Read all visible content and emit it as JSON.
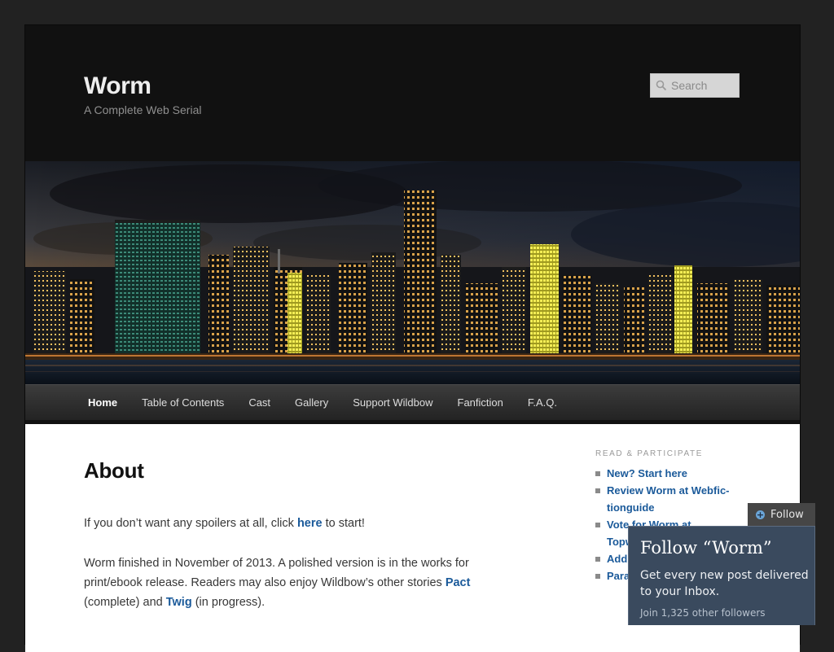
{
  "site": {
    "title": "Worm",
    "description": "A Complete Web Serial"
  },
  "search": {
    "placeholder": "Search",
    "icon": "search-icon"
  },
  "banner": {
    "image": "city-skyline-at-dusk"
  },
  "nav": {
    "items": [
      {
        "label": "Home",
        "active": true
      },
      {
        "label": "Table of Contents"
      },
      {
        "label": "Cast"
      },
      {
        "label": "Gallery"
      },
      {
        "label": "Support Wildbow"
      },
      {
        "label": "Fanfiction"
      },
      {
        "label": "F.A.Q."
      }
    ]
  },
  "main": {
    "title": "About",
    "para1": {
      "before": "If you don’t want any spoilers at all, click ",
      "link": "here",
      "after": " to start!"
    },
    "para2": {
      "text1": "Worm finished in November of 2013.  A polished version is in the works for print/ebook release.  Readers may also enjoy Wildbow’s other stories ",
      "link1": "Pact",
      "text2": " (complete) and ",
      "link2": "Twig",
      "text3": " (in progress)."
    }
  },
  "sidebar": {
    "title": "READ & PARTICIPATE",
    "items": [
      {
        "label": "New? Start here"
      },
      {
        "label": "Review Worm at Webfic-tionguide"
      },
      {
        "label": "Vote for Worm at Topwebfic-tion"
      },
      {
        "label": "Add Tr... TVtrop..."
      },
      {
        "label": "Parahu..."
      }
    ]
  },
  "follow": {
    "tab_label": "Follow",
    "heading": "Follow “Worm”",
    "text": "Get every new post delivered to your Inbox.",
    "count_text": "Join 1,325 other followers"
  },
  "colors": {
    "page_bg": "#222222",
    "header_bg": "#111111",
    "link": "#1b5a9a",
    "follow_panel": "#3a4a5e"
  }
}
